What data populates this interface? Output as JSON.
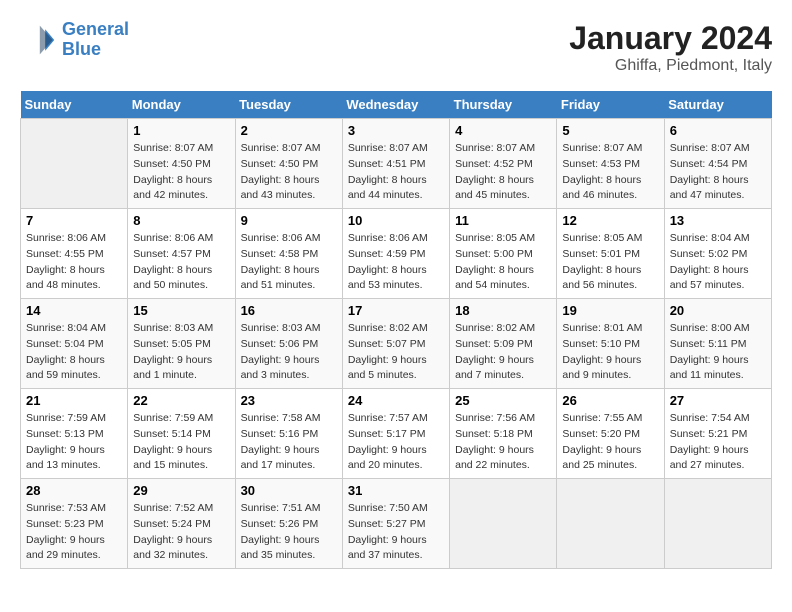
{
  "header": {
    "logo_line1": "General",
    "logo_line2": "Blue",
    "title": "January 2024",
    "subtitle": "Ghiffa, Piedmont, Italy"
  },
  "columns": [
    "Sunday",
    "Monday",
    "Tuesday",
    "Wednesday",
    "Thursday",
    "Friday",
    "Saturday"
  ],
  "weeks": [
    [
      {
        "day": "",
        "sunrise": "",
        "sunset": "",
        "daylight": ""
      },
      {
        "day": "1",
        "sunrise": "Sunrise: 8:07 AM",
        "sunset": "Sunset: 4:50 PM",
        "daylight": "Daylight: 8 hours and 42 minutes."
      },
      {
        "day": "2",
        "sunrise": "Sunrise: 8:07 AM",
        "sunset": "Sunset: 4:50 PM",
        "daylight": "Daylight: 8 hours and 43 minutes."
      },
      {
        "day": "3",
        "sunrise": "Sunrise: 8:07 AM",
        "sunset": "Sunset: 4:51 PM",
        "daylight": "Daylight: 8 hours and 44 minutes."
      },
      {
        "day": "4",
        "sunrise": "Sunrise: 8:07 AM",
        "sunset": "Sunset: 4:52 PM",
        "daylight": "Daylight: 8 hours and 45 minutes."
      },
      {
        "day": "5",
        "sunrise": "Sunrise: 8:07 AM",
        "sunset": "Sunset: 4:53 PM",
        "daylight": "Daylight: 8 hours and 46 minutes."
      },
      {
        "day": "6",
        "sunrise": "Sunrise: 8:07 AM",
        "sunset": "Sunset: 4:54 PM",
        "daylight": "Daylight: 8 hours and 47 minutes."
      }
    ],
    [
      {
        "day": "7",
        "sunrise": "Sunrise: 8:06 AM",
        "sunset": "Sunset: 4:55 PM",
        "daylight": "Daylight: 8 hours and 48 minutes."
      },
      {
        "day": "8",
        "sunrise": "Sunrise: 8:06 AM",
        "sunset": "Sunset: 4:57 PM",
        "daylight": "Daylight: 8 hours and 50 minutes."
      },
      {
        "day": "9",
        "sunrise": "Sunrise: 8:06 AM",
        "sunset": "Sunset: 4:58 PM",
        "daylight": "Daylight: 8 hours and 51 minutes."
      },
      {
        "day": "10",
        "sunrise": "Sunrise: 8:06 AM",
        "sunset": "Sunset: 4:59 PM",
        "daylight": "Daylight: 8 hours and 53 minutes."
      },
      {
        "day": "11",
        "sunrise": "Sunrise: 8:05 AM",
        "sunset": "Sunset: 5:00 PM",
        "daylight": "Daylight: 8 hours and 54 minutes."
      },
      {
        "day": "12",
        "sunrise": "Sunrise: 8:05 AM",
        "sunset": "Sunset: 5:01 PM",
        "daylight": "Daylight: 8 hours and 56 minutes."
      },
      {
        "day": "13",
        "sunrise": "Sunrise: 8:04 AM",
        "sunset": "Sunset: 5:02 PM",
        "daylight": "Daylight: 8 hours and 57 minutes."
      }
    ],
    [
      {
        "day": "14",
        "sunrise": "Sunrise: 8:04 AM",
        "sunset": "Sunset: 5:04 PM",
        "daylight": "Daylight: 8 hours and 59 minutes."
      },
      {
        "day": "15",
        "sunrise": "Sunrise: 8:03 AM",
        "sunset": "Sunset: 5:05 PM",
        "daylight": "Daylight: 9 hours and 1 minute."
      },
      {
        "day": "16",
        "sunrise": "Sunrise: 8:03 AM",
        "sunset": "Sunset: 5:06 PM",
        "daylight": "Daylight: 9 hours and 3 minutes."
      },
      {
        "day": "17",
        "sunrise": "Sunrise: 8:02 AM",
        "sunset": "Sunset: 5:07 PM",
        "daylight": "Daylight: 9 hours and 5 minutes."
      },
      {
        "day": "18",
        "sunrise": "Sunrise: 8:02 AM",
        "sunset": "Sunset: 5:09 PM",
        "daylight": "Daylight: 9 hours and 7 minutes."
      },
      {
        "day": "19",
        "sunrise": "Sunrise: 8:01 AM",
        "sunset": "Sunset: 5:10 PM",
        "daylight": "Daylight: 9 hours and 9 minutes."
      },
      {
        "day": "20",
        "sunrise": "Sunrise: 8:00 AM",
        "sunset": "Sunset: 5:11 PM",
        "daylight": "Daylight: 9 hours and 11 minutes."
      }
    ],
    [
      {
        "day": "21",
        "sunrise": "Sunrise: 7:59 AM",
        "sunset": "Sunset: 5:13 PM",
        "daylight": "Daylight: 9 hours and 13 minutes."
      },
      {
        "day": "22",
        "sunrise": "Sunrise: 7:59 AM",
        "sunset": "Sunset: 5:14 PM",
        "daylight": "Daylight: 9 hours and 15 minutes."
      },
      {
        "day": "23",
        "sunrise": "Sunrise: 7:58 AM",
        "sunset": "Sunset: 5:16 PM",
        "daylight": "Daylight: 9 hours and 17 minutes."
      },
      {
        "day": "24",
        "sunrise": "Sunrise: 7:57 AM",
        "sunset": "Sunset: 5:17 PM",
        "daylight": "Daylight: 9 hours and 20 minutes."
      },
      {
        "day": "25",
        "sunrise": "Sunrise: 7:56 AM",
        "sunset": "Sunset: 5:18 PM",
        "daylight": "Daylight: 9 hours and 22 minutes."
      },
      {
        "day": "26",
        "sunrise": "Sunrise: 7:55 AM",
        "sunset": "Sunset: 5:20 PM",
        "daylight": "Daylight: 9 hours and 25 minutes."
      },
      {
        "day": "27",
        "sunrise": "Sunrise: 7:54 AM",
        "sunset": "Sunset: 5:21 PM",
        "daylight": "Daylight: 9 hours and 27 minutes."
      }
    ],
    [
      {
        "day": "28",
        "sunrise": "Sunrise: 7:53 AM",
        "sunset": "Sunset: 5:23 PM",
        "daylight": "Daylight: 9 hours and 29 minutes."
      },
      {
        "day": "29",
        "sunrise": "Sunrise: 7:52 AM",
        "sunset": "Sunset: 5:24 PM",
        "daylight": "Daylight: 9 hours and 32 minutes."
      },
      {
        "day": "30",
        "sunrise": "Sunrise: 7:51 AM",
        "sunset": "Sunset: 5:26 PM",
        "daylight": "Daylight: 9 hours and 35 minutes."
      },
      {
        "day": "31",
        "sunrise": "Sunrise: 7:50 AM",
        "sunset": "Sunset: 5:27 PM",
        "daylight": "Daylight: 9 hours and 37 minutes."
      },
      {
        "day": "",
        "sunrise": "",
        "sunset": "",
        "daylight": ""
      },
      {
        "day": "",
        "sunrise": "",
        "sunset": "",
        "daylight": ""
      },
      {
        "day": "",
        "sunrise": "",
        "sunset": "",
        "daylight": ""
      }
    ]
  ]
}
